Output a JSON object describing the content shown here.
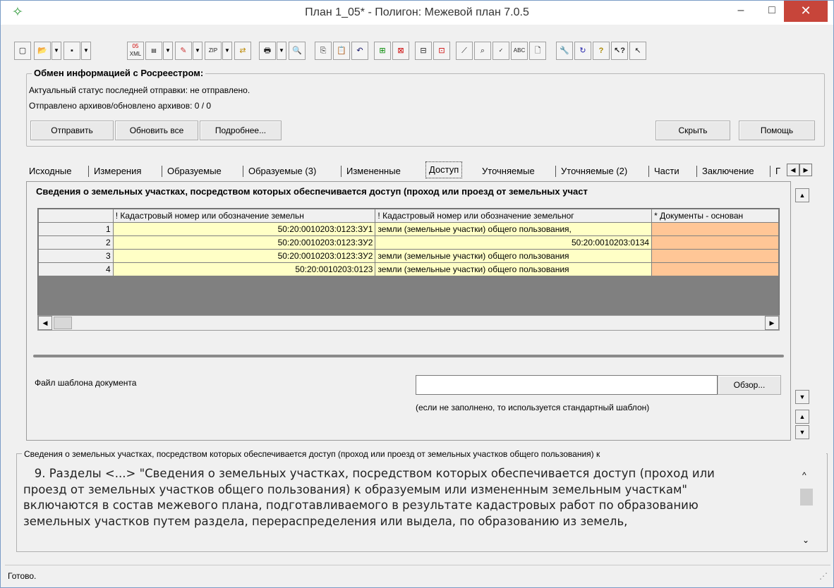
{
  "window": {
    "title": "План 1_05* - Полигон: Межевой план 7.0.5",
    "minimize": "–",
    "maximize": "□",
    "close": "✕"
  },
  "toolbar": {
    "icons": [
      "new-icon",
      "open-icon",
      "save-icon",
      "xml-05-icon",
      "xml-export-icon",
      "stamp-icon",
      "zip-icon",
      "swap-icon",
      "print-icon",
      "preview-icon",
      "copy-icon",
      "paste-icon",
      "undo-icon",
      "add-row-icon",
      "delete-row-icon",
      "insert-icon",
      "remove-icon",
      "wand-icon",
      "find-icon",
      "xml-check-icon",
      "spell-icon",
      "doc-icon",
      "tools-icon",
      "refresh-icon",
      "help-icon",
      "context-help-icon",
      "pointer-icon"
    ],
    "labels": {
      "xml05_top": "05",
      "xml": "XML",
      "zip": "ZIP",
      "abc": "ABC"
    }
  },
  "rosreestr": {
    "title": "Обмен информацией с Росреестром:",
    "status_line": "Актуальный статус последней отправки: не отправлено.",
    "count_line": "Отправлено архивов/обновлено архивов: 0 / 0",
    "send_label": "Отправить",
    "refresh_all_label": "Обновить все",
    "details_label": "Подробнее...",
    "hide_label": "Скрыть",
    "help_label": "Помощь"
  },
  "tabs": [
    {
      "label": "Исходные"
    },
    {
      "label": "Измерения"
    },
    {
      "label": "Образуемые"
    },
    {
      "label": "Образуемые (3)"
    },
    {
      "label": "Измененные"
    },
    {
      "label": "Доступ"
    },
    {
      "label": "Уточняемые"
    },
    {
      "label": "Уточняемые (2)"
    },
    {
      "label": "Части"
    },
    {
      "label": "Заключение"
    },
    {
      "label": "Г"
    }
  ],
  "active_tab": "Доступ",
  "panel": {
    "title": "Сведения о земельных участках, посредством которых обеспечивается доступ (проход или проезд от земельных участ",
    "columns": [
      "! Кадастровый номер или обозначение земельн",
      "! Кадастровый номер или обозначение земельног",
      "* Документы - основан"
    ],
    "rows": [
      {
        "n": "1",
        "c1": "50:20:0010203:0123:ЗУ1",
        "c2": "земли (земельные участки) общего пользования,",
        "c3": ""
      },
      {
        "n": "2",
        "c1": "50:20:0010203:0123:ЗУ2",
        "c2": "50:20:0010203:0134",
        "c3": ""
      },
      {
        "n": "3",
        "c1": "50:20:0010203:0123:ЗУ2",
        "c2": "земли (земельные участки) общего пользования",
        "c3": ""
      },
      {
        "n": "4",
        "c1": "50:20:0010203:0123",
        "c2": "земли (земельные участки) общего пользования",
        "c3": ""
      }
    ],
    "template_label": "Файл шаблона документа",
    "template_value": "",
    "browse_label": "Обзор...",
    "template_hint": "(если не заполнено, то используется стандартный шаблон)"
  },
  "help": {
    "legend": "Сведения о земельных участках, посредством которых обеспечивается доступ (проход или проезд от земельных участков общего пользования) к",
    "lines": [
      "   9. Разделы <...> \"Сведения о земельных участках, посредством которых обеспечивается доступ (проход или",
      "проезд от земельных участков общего пользования) к образуемым или измененным земельным участкам\"",
      "включаются в состав межевого плана, подготавливаемого в результате кадастровых работ по образованию",
      "земельных участков путем раздела, перераспределения или выдела, по образованию из земель,"
    ]
  },
  "status": {
    "text": "Готово."
  }
}
